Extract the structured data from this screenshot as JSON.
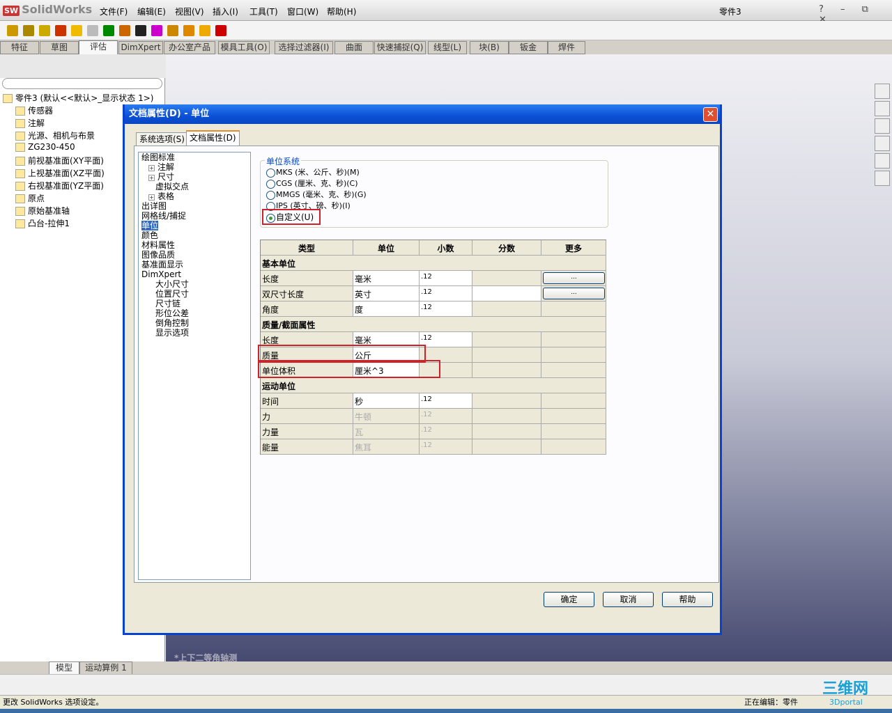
{
  "app": {
    "logo": "SolidWorks",
    "doc_title": "零件3",
    "window_controls": "? – ⧉ ✕"
  },
  "menu": [
    "文件(F)",
    "编辑(E)",
    "视图(V)",
    "插入(I)",
    "工具(T)",
    "窗口(W)",
    "帮助(H)"
  ],
  "cmd_tabs": [
    "特征",
    "草图",
    "评估",
    "DimXpert",
    "办公室产品",
    "模具工具(O)",
    "选择过滤器(I)",
    "曲面",
    "快速捕捉(Q)",
    "线型(L)",
    "块(B)",
    "钣金",
    "焊件"
  ],
  "active_cmd_tab": "评估",
  "feature_tree": {
    "root": "零件3  (默认<<默认>_显示状态 1>)",
    "items": [
      "传感器",
      "注解",
      "光源、相机与布景",
      "ZG230-450",
      "前视基准面(XY平面)",
      "上视基准面(XZ平面)",
      "右视基准面(YZ平面)",
      "原点",
      "原始基准轴",
      "凸台-拉伸1"
    ]
  },
  "view_label": "*上下二等角轴测",
  "bottom_tabs": [
    "模型",
    "运动算例 1"
  ],
  "status": {
    "left": "更改 SolidWorks 选项设定。",
    "editing": "正在编辑：零件"
  },
  "watermark": "3Dportal",
  "dialog": {
    "title": "文档属性(D) - 单位",
    "tabs": [
      "系统选项(S)",
      "文档属性(D)"
    ],
    "tree": [
      "绘图标准",
      "注解",
      "尺寸",
      "虚拟交点",
      "表格",
      "出详图",
      "网格线/捕捉",
      "单位",
      "颜色",
      "材料属性",
      "图像品质",
      "基准面显示",
      "DimXpert",
      "大小尺寸",
      "位置尺寸",
      "尺寸链",
      "形位公差",
      "倒角控制",
      "显示选项"
    ],
    "selected_tree": "单位",
    "unit_system": {
      "title": "单位系统",
      "options": [
        "MKS (米、公斤、秒)(M)",
        "CGS (厘米、克、秒)(C)",
        "MMGS (毫米、克、秒)(G)",
        "IPS (英寸、磅、秒)(I)",
        "自定义(U)"
      ],
      "selected": "自定义(U)"
    },
    "table": {
      "headers": [
        "类型",
        "单位",
        "小数",
        "分数",
        "更多"
      ],
      "rows": [
        {
          "section": "基本单位"
        },
        {
          "type": "长度",
          "unit": "毫米",
          "decimal": ".12",
          "more": "..."
        },
        {
          "type": "双尺寸长度",
          "unit": "英寸",
          "decimal": ".12",
          "more": "..."
        },
        {
          "type": "角度",
          "unit": "度",
          "decimal": ".12"
        },
        {
          "section": "质量/截面属性"
        },
        {
          "type": "长度",
          "unit": "毫米",
          "decimal": ".12"
        },
        {
          "type": "质量",
          "unit": "公斤",
          "highlight": true
        },
        {
          "type": "单位体积",
          "unit": "厘米^3",
          "highlight": true
        },
        {
          "section": "运动单位"
        },
        {
          "type": "时间",
          "unit": "秒",
          "decimal": ".12"
        },
        {
          "type": "力",
          "unit": "牛顿",
          "decimal": ".12",
          "disabled": true
        },
        {
          "type": "力量",
          "unit": "瓦",
          "decimal": ".12",
          "disabled": true
        },
        {
          "type": "能量",
          "unit": "焦耳",
          "decimal": ".12",
          "disabled": true
        }
      ]
    },
    "buttons": {
      "ok": "确定",
      "cancel": "取消",
      "help": "帮助"
    }
  },
  "colors": {
    "title_bar": "#0b50d5",
    "highlight_box": "#d0202a",
    "selection": "#316ac5"
  }
}
